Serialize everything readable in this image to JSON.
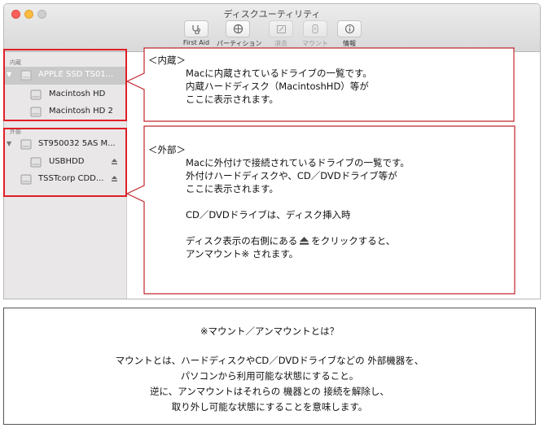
{
  "window": {
    "title": "ディスクユーティリティ",
    "toolbar": [
      {
        "label": "First Aid",
        "icon": "stethoscope-icon",
        "enabled": true
      },
      {
        "label": "パーティション",
        "icon": "partition-icon",
        "enabled": true
      },
      {
        "label": "消去",
        "icon": "erase-icon",
        "enabled": false
      },
      {
        "label": "マウント",
        "icon": "mount-icon",
        "enabled": false
      },
      {
        "label": "情報",
        "icon": "info-icon",
        "enabled": true
      }
    ]
  },
  "sidebar": {
    "internal_header": "内蔵",
    "external_header": "外部",
    "internal_items": [
      {
        "label": "APPLE SSD TS01...",
        "selected": true,
        "kind": "disk"
      },
      {
        "label": "Macintosh HD",
        "kind": "volume"
      },
      {
        "label": "Macintosh HD 2",
        "kind": "volume"
      }
    ],
    "external_items": [
      {
        "label": "ST950032 5AS M...",
        "kind": "disk"
      },
      {
        "label": "USBHDD",
        "kind": "volume",
        "eject": true
      },
      {
        "label": "TSSTcorp CDD...",
        "kind": "disk",
        "eject": true
      }
    ]
  },
  "callout_internal": {
    "heading": "＜内蔵＞",
    "lines": [
      "Macに内蔵されているドライブの一覧です。",
      "内蔵ハードディスク（MacintoshHD）等が",
      "ここに表示されます。"
    ]
  },
  "callout_external": {
    "heading": "＜外部＞",
    "lines": [
      "Macに外付けで接続されているドライブの一覧です。",
      "外付けハードディスクや、CD／DVDドライブ等が",
      "ここに表示されます。",
      "",
      "CD／DVDドライブは、ディスク挿入時",
      ""
    ],
    "eject_line_before": "ディスク表示の右側にある",
    "eject_line_after": "をクリックすると、",
    "last_line": "アンマウント※ されます。"
  },
  "note": {
    "title": "※マウント／アンマウントとは？",
    "lines": [
      "マウントとは、ハードディスクやCD／DVDドライブなどの 外部機器を、",
      "パソコンから利用可能な状態にすること。",
      "逆に、アンマウントはそれらの 機器との 接続を解除し、",
      "取り外し可能な状態にすることを意味します。"
    ]
  },
  "colors": {
    "highlight_border": "#e01f26",
    "selection": "#c9c9c9"
  }
}
